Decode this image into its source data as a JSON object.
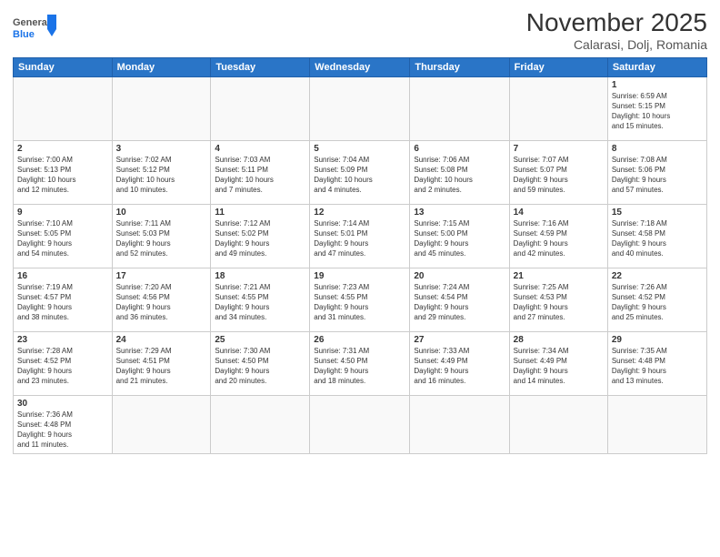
{
  "logo": {
    "line1": "General",
    "line2": "Blue"
  },
  "title": "November 2025",
  "subtitle": "Calarasi, Dolj, Romania",
  "weekdays": [
    "Sunday",
    "Monday",
    "Tuesday",
    "Wednesday",
    "Thursday",
    "Friday",
    "Saturday"
  ],
  "weeks": [
    [
      {
        "day": "",
        "info": ""
      },
      {
        "day": "",
        "info": ""
      },
      {
        "day": "",
        "info": ""
      },
      {
        "day": "",
        "info": ""
      },
      {
        "day": "",
        "info": ""
      },
      {
        "day": "",
        "info": ""
      },
      {
        "day": "1",
        "info": "Sunrise: 6:59 AM\nSunset: 5:15 PM\nDaylight: 10 hours\nand 15 minutes."
      }
    ],
    [
      {
        "day": "2",
        "info": "Sunrise: 7:00 AM\nSunset: 5:13 PM\nDaylight: 10 hours\nand 12 minutes."
      },
      {
        "day": "3",
        "info": "Sunrise: 7:02 AM\nSunset: 5:12 PM\nDaylight: 10 hours\nand 10 minutes."
      },
      {
        "day": "4",
        "info": "Sunrise: 7:03 AM\nSunset: 5:11 PM\nDaylight: 10 hours\nand 7 minutes."
      },
      {
        "day": "5",
        "info": "Sunrise: 7:04 AM\nSunset: 5:09 PM\nDaylight: 10 hours\nand 4 minutes."
      },
      {
        "day": "6",
        "info": "Sunrise: 7:06 AM\nSunset: 5:08 PM\nDaylight: 10 hours\nand 2 minutes."
      },
      {
        "day": "7",
        "info": "Sunrise: 7:07 AM\nSunset: 5:07 PM\nDaylight: 9 hours\nand 59 minutes."
      },
      {
        "day": "8",
        "info": "Sunrise: 7:08 AM\nSunset: 5:06 PM\nDaylight: 9 hours\nand 57 minutes."
      }
    ],
    [
      {
        "day": "9",
        "info": "Sunrise: 7:10 AM\nSunset: 5:05 PM\nDaylight: 9 hours\nand 54 minutes."
      },
      {
        "day": "10",
        "info": "Sunrise: 7:11 AM\nSunset: 5:03 PM\nDaylight: 9 hours\nand 52 minutes."
      },
      {
        "day": "11",
        "info": "Sunrise: 7:12 AM\nSunset: 5:02 PM\nDaylight: 9 hours\nand 49 minutes."
      },
      {
        "day": "12",
        "info": "Sunrise: 7:14 AM\nSunset: 5:01 PM\nDaylight: 9 hours\nand 47 minutes."
      },
      {
        "day": "13",
        "info": "Sunrise: 7:15 AM\nSunset: 5:00 PM\nDaylight: 9 hours\nand 45 minutes."
      },
      {
        "day": "14",
        "info": "Sunrise: 7:16 AM\nSunset: 4:59 PM\nDaylight: 9 hours\nand 42 minutes."
      },
      {
        "day": "15",
        "info": "Sunrise: 7:18 AM\nSunset: 4:58 PM\nDaylight: 9 hours\nand 40 minutes."
      }
    ],
    [
      {
        "day": "16",
        "info": "Sunrise: 7:19 AM\nSunset: 4:57 PM\nDaylight: 9 hours\nand 38 minutes."
      },
      {
        "day": "17",
        "info": "Sunrise: 7:20 AM\nSunset: 4:56 PM\nDaylight: 9 hours\nand 36 minutes."
      },
      {
        "day": "18",
        "info": "Sunrise: 7:21 AM\nSunset: 4:55 PM\nDaylight: 9 hours\nand 34 minutes."
      },
      {
        "day": "19",
        "info": "Sunrise: 7:23 AM\nSunset: 4:55 PM\nDaylight: 9 hours\nand 31 minutes."
      },
      {
        "day": "20",
        "info": "Sunrise: 7:24 AM\nSunset: 4:54 PM\nDaylight: 9 hours\nand 29 minutes."
      },
      {
        "day": "21",
        "info": "Sunrise: 7:25 AM\nSunset: 4:53 PM\nDaylight: 9 hours\nand 27 minutes."
      },
      {
        "day": "22",
        "info": "Sunrise: 7:26 AM\nSunset: 4:52 PM\nDaylight: 9 hours\nand 25 minutes."
      }
    ],
    [
      {
        "day": "23",
        "info": "Sunrise: 7:28 AM\nSunset: 4:52 PM\nDaylight: 9 hours\nand 23 minutes."
      },
      {
        "day": "24",
        "info": "Sunrise: 7:29 AM\nSunset: 4:51 PM\nDaylight: 9 hours\nand 21 minutes."
      },
      {
        "day": "25",
        "info": "Sunrise: 7:30 AM\nSunset: 4:50 PM\nDaylight: 9 hours\nand 20 minutes."
      },
      {
        "day": "26",
        "info": "Sunrise: 7:31 AM\nSunset: 4:50 PM\nDaylight: 9 hours\nand 18 minutes."
      },
      {
        "day": "27",
        "info": "Sunrise: 7:33 AM\nSunset: 4:49 PM\nDaylight: 9 hours\nand 16 minutes."
      },
      {
        "day": "28",
        "info": "Sunrise: 7:34 AM\nSunset: 4:49 PM\nDaylight: 9 hours\nand 14 minutes."
      },
      {
        "day": "29",
        "info": "Sunrise: 7:35 AM\nSunset: 4:48 PM\nDaylight: 9 hours\nand 13 minutes."
      }
    ],
    [
      {
        "day": "30",
        "info": "Sunrise: 7:36 AM\nSunset: 4:48 PM\nDaylight: 9 hours\nand 11 minutes."
      },
      {
        "day": "",
        "info": ""
      },
      {
        "day": "",
        "info": ""
      },
      {
        "day": "",
        "info": ""
      },
      {
        "day": "",
        "info": ""
      },
      {
        "day": "",
        "info": ""
      },
      {
        "day": "",
        "info": ""
      }
    ]
  ]
}
